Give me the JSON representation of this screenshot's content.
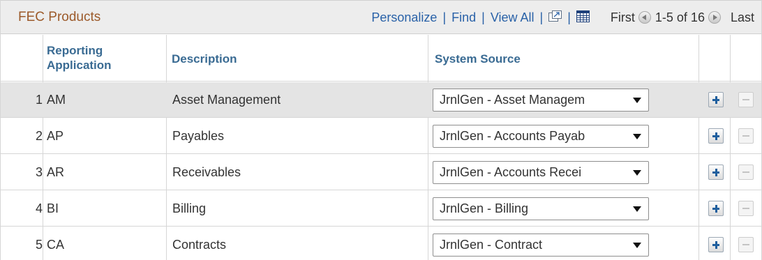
{
  "grid": {
    "title": "FEC Products",
    "nav": {
      "personalize": "Personalize",
      "find": "Find",
      "view_all": "View All",
      "separator": "|",
      "first": "First",
      "range": "1-5 of 16",
      "last": "Last"
    },
    "columns": {
      "reporting_line1": "Reporting",
      "reporting_line2": "Application",
      "description": "Description",
      "system_source": "System Source"
    },
    "rows": [
      {
        "num": "1",
        "app": "AM",
        "description": "Asset Management",
        "source": "JrnlGen - Asset Managem"
      },
      {
        "num": "2",
        "app": "AP",
        "description": "Payables",
        "source": "JrnlGen - Accounts Payab"
      },
      {
        "num": "3",
        "app": "AR",
        "description": "Receivables",
        "source": "JrnlGen - Accounts Recei"
      },
      {
        "num": "4",
        "app": "BI",
        "description": "Billing",
        "source": "JrnlGen - Billing"
      },
      {
        "num": "5",
        "app": "CA",
        "description": "Contracts",
        "source": "JrnlGen - Contract"
      }
    ],
    "selected_row": "1",
    "icons": {
      "zoom": "zoom-window-icon",
      "download": "download-spreadsheet-icon",
      "prev": "previous-arrow-icon",
      "next": "next-arrow-icon",
      "add": "add-row-icon",
      "delete": "delete-row-icon"
    },
    "colors": {
      "title": "#9c5a2a",
      "link": "#2a62a8",
      "header": "#3a6b93",
      "selected_row_bg": "#e4e4e4"
    }
  }
}
